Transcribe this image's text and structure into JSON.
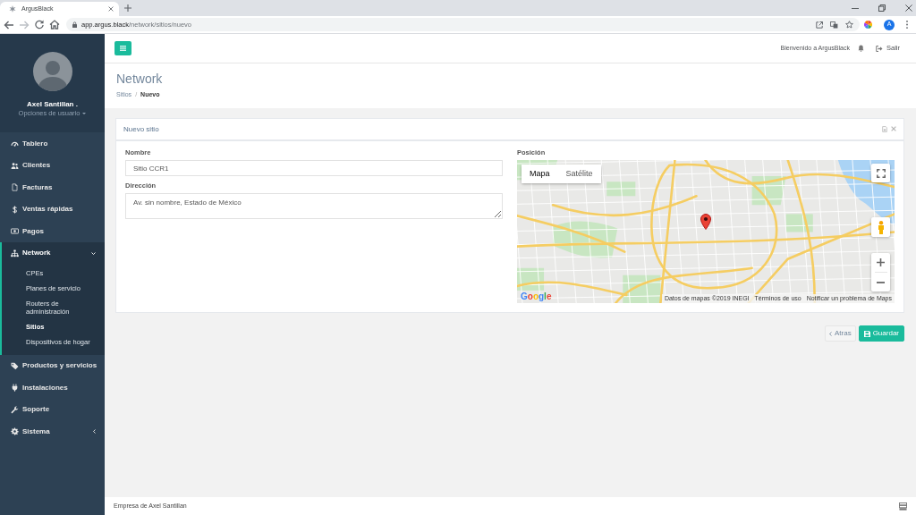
{
  "browser": {
    "tab_title": "ArgusBlack",
    "forward_disabled": true,
    "url": {
      "host": "app.argus.black",
      "path": "/network/sitios/nuevo"
    },
    "profile_initial": "A"
  },
  "sidebar": {
    "user": {
      "name": "Axel Santillan .",
      "options": "Opciones de usuario"
    },
    "items": [
      {
        "label": "Tablero",
        "kind": "link",
        "selected": false
      },
      {
        "label": "Clientes",
        "kind": "link",
        "selected": false
      },
      {
        "label": "Facturas",
        "kind": "link",
        "selected": false
      },
      {
        "label": "Ventas rápidas",
        "kind": "link",
        "selected": false
      },
      {
        "label": "Pagos",
        "kind": "link",
        "selected": false
      },
      {
        "label": "Network",
        "kind": "group",
        "selected": true,
        "expanded": true,
        "children": [
          {
            "label": "CPEs",
            "selected": false
          },
          {
            "label": "Planes de servicio",
            "selected": false
          },
          {
            "label": "Routers de administración",
            "selected": false
          },
          {
            "label": "Sitios",
            "selected": true
          },
          {
            "label": "Dispositivos de hogar",
            "selected": false
          }
        ]
      },
      {
        "label": "Productos y servicios",
        "kind": "link",
        "selected": false
      },
      {
        "label": "Instalaciones",
        "kind": "link",
        "selected": false
      },
      {
        "label": "Soporte",
        "kind": "link",
        "selected": false
      },
      {
        "label": "Sistema",
        "kind": "group",
        "selected": false,
        "expanded": false
      }
    ]
  },
  "topbar": {
    "welcome": "Bienvenido a ArgusBlack",
    "logout": "Salir"
  },
  "page": {
    "title": "Network",
    "breadcrumb": [
      {
        "label": "Sitios",
        "selected": false,
        "separator": "/"
      },
      {
        "label": "Nuevo",
        "selected": true
      }
    ]
  },
  "panel": {
    "title": "Nuevo sitio",
    "fields": [
      {
        "label": "Nombre",
        "kind": "input",
        "value": "Sitio CCR1"
      },
      {
        "label": "Dirección",
        "kind": "textarea",
        "value": "Av. sin nombre, Estado de México"
      }
    ],
    "map": {
      "label": "Posición",
      "types": [
        {
          "label": "Mapa",
          "selected": true
        },
        {
          "label": "Satélite",
          "selected": false
        }
      ],
      "logo": "Google",
      "attribution": [
        "Datos de mapas ©2019 INEGI",
        "Términos de uso",
        "Notificar un problema de Maps"
      ]
    }
  },
  "actions": [
    {
      "label": "Atras",
      "kind": "back"
    },
    {
      "label": "Guardar",
      "kind": "save"
    }
  ],
  "footer": {
    "text": "Empresa de Axel Santillan"
  }
}
